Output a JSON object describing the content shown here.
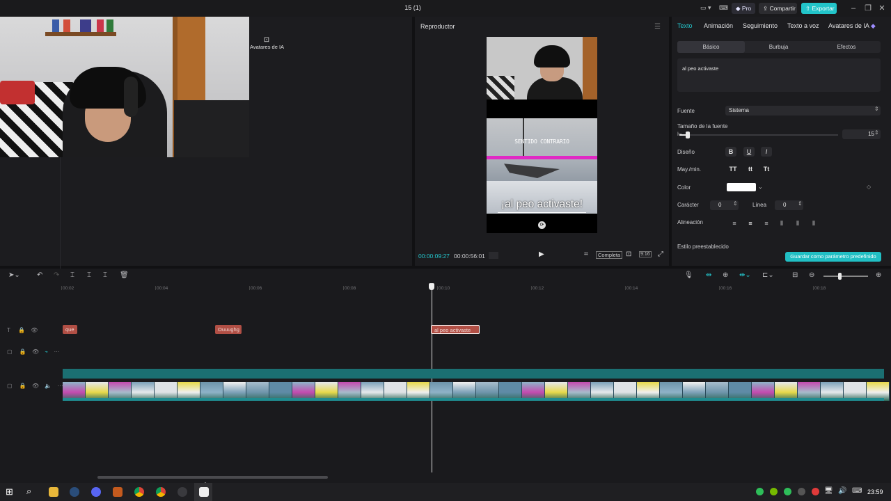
{
  "window": {
    "title": "15 (1)",
    "pro_label": "Pro",
    "share_label": "Compartir",
    "export_label": "Exportar"
  },
  "media": {
    "tab_label": "Avatares de IA"
  },
  "player": {
    "title": "Reproductor",
    "sign_text": "SENTIDO CONTRARIO",
    "caption": "¡al peo activaste!",
    "current_time": "00:00:09:27",
    "total_time": "00:00:56:01",
    "complete_label": "Completa",
    "ratio_label": "9:16"
  },
  "text_panel": {
    "tabs": [
      "Texto",
      "Animación",
      "Seguimiento",
      "Texto a voz",
      "Avatares de IA"
    ],
    "subtabs": [
      "Básico",
      "Burbuja",
      "Efectos"
    ],
    "text_value": "al peo activaste",
    "font_label": "Fuente",
    "font_value": "Sistema",
    "size_label": "Tamaño de la fuente",
    "size_value": "15",
    "size_fraction": 0.04,
    "design_label": "Diseño",
    "bold": "B",
    "underline": "U",
    "italic": "I",
    "case_label": "May./min.",
    "case_upper": "TT",
    "case_lower": "tt",
    "case_title": "Tt",
    "color_label": "Color",
    "color_value": "#ffffff",
    "char_label": "Carácter",
    "char_value": "0",
    "line_label": "Línea",
    "line_value": "0",
    "align_label": "Alineación",
    "preset_label": "Estilo preestablecido",
    "save_preset_label": "Guardar como parámetro predefinido"
  },
  "timeline": {
    "ticks": [
      "00:02",
      "00:04",
      "00:06",
      "00:08",
      "00:10",
      "00:12",
      "00:14",
      "00:16",
      "00:18"
    ],
    "clips": [
      "que",
      "Ouuughg",
      "al peo activaste"
    ]
  },
  "taskbar": {
    "clock": "23:59"
  },
  "colors": {
    "accent": "#22c4c9",
    "text_clip": "#b14f45",
    "audio_track": "#1b6f72"
  }
}
